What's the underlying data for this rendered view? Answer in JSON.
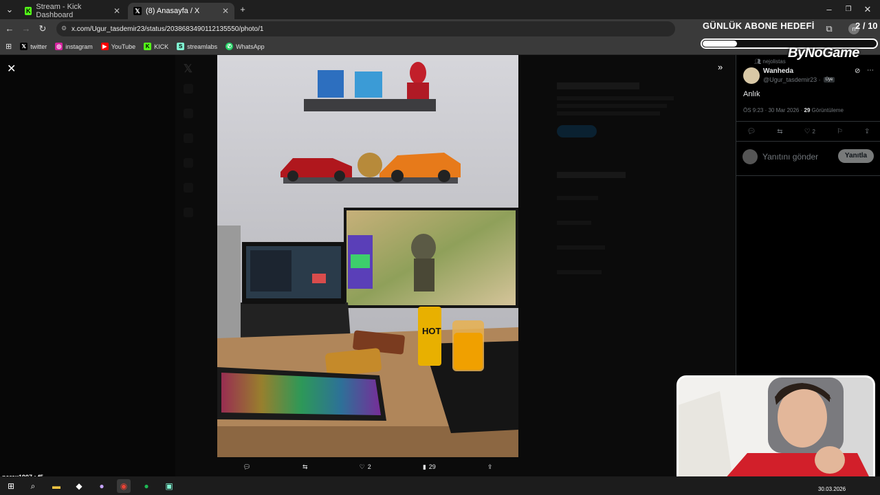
{
  "tabs": [
    {
      "title": "Stream - Kick Dashboard",
      "icon": "kick-icon",
      "active": false
    },
    {
      "title": "(8) Anasayfa / X",
      "icon": "x-logo-icon",
      "active": true
    }
  ],
  "address": {
    "url": "x.com/Ugur_tasdemir23/status/2038683490112135550/photo/1"
  },
  "bookmarks": [
    {
      "label": "twitter",
      "icon": "x-logo-icon",
      "color": "#000000"
    },
    {
      "label": "instagram",
      "icon": "instagram-icon",
      "color": "#d6249f"
    },
    {
      "label": "YouTube",
      "icon": "youtube-icon",
      "color": "#ff0000"
    },
    {
      "label": "KICK",
      "icon": "kick-icon",
      "color": "#53fc18"
    },
    {
      "label": "streamlabs",
      "icon": "streamlabs-icon",
      "color": "#80f5d2"
    },
    {
      "label": "WhatsApp",
      "icon": "whatsapp-icon",
      "color": "#25d366"
    }
  ],
  "tweet": {
    "social_context": "nejolistas",
    "display_name": "Wanheda",
    "handle": "@Ugur_tasdemir23 ·",
    "member_badge": "Üye",
    "text": "Anlık",
    "meta_time": "ÖS 9:23 · 30 Mar 2026 ·",
    "views_count": "29",
    "views_label": "Görüntüleme",
    "likes": "2",
    "reply_placeholder": "Yanıtını gönder",
    "reply_button": "Yanıtla"
  },
  "photo_actions": {
    "likes": "2",
    "views": "29"
  },
  "overlay": {
    "goal_title": "GÜNLÜK ABONE HEDEFİ",
    "goal_count": "2 / 10",
    "goal_progress": 0.2,
    "brand": "ByNoGame"
  },
  "chat": {
    "line": "narax1907 : f5"
  },
  "taskbar": {
    "date": "30.03.2026"
  },
  "colors": {
    "accent": "#1d9bf0",
    "x_bg": "#000000",
    "kick_green": "#53fc18"
  }
}
